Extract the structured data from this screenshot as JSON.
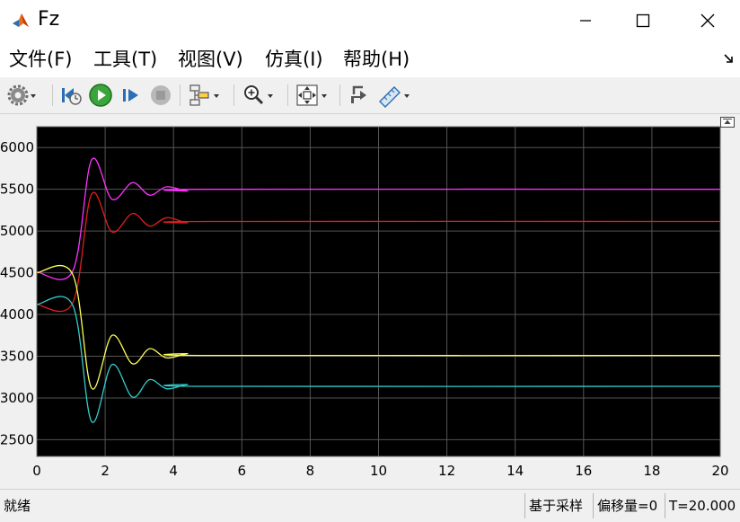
{
  "window": {
    "title": "Fz"
  },
  "menu": {
    "items": [
      "文件(F)",
      "工具(T)",
      "视图(V)",
      "仿真(I)",
      "帮助(H)"
    ]
  },
  "toolbar": {
    "buttons": [
      "settings-icon",
      "step-back-icon",
      "run-icon",
      "step-forward-icon",
      "stop-icon",
      "highlight-icon",
      "zoom-icon",
      "fit-to-view-icon",
      "restore-icon",
      "measure-icon"
    ]
  },
  "status": {
    "left": "就绪",
    "sample": "基于采样",
    "offset": "偏移量=0",
    "time": "T=20.000"
  },
  "colors": {
    "magenta": "#ff33ff",
    "red": "#e01f1f",
    "yellow": "#ffff55",
    "cyan": "#33cccc",
    "plot_bg": "#000000",
    "grid": "#555555"
  },
  "chart_data": {
    "type": "line",
    "title": "",
    "xlabel": "",
    "ylabel": "",
    "xlim": [
      0,
      20
    ],
    "ylim": [
      2300,
      6250
    ],
    "x_ticks": [
      "0",
      "2",
      "4",
      "6",
      "8",
      "10",
      "12",
      "14",
      "16",
      "18",
      "20"
    ],
    "y_ticks": [
      "2500",
      "3000",
      "3500",
      "4000",
      "4500",
      "5000",
      "5500",
      "6000"
    ],
    "x_tick_values": [
      0,
      2,
      4,
      6,
      8,
      10,
      12,
      14,
      16,
      18,
      20
    ],
    "y_tick_values": [
      2500,
      3000,
      3500,
      4000,
      4500,
      5000,
      5500,
      6000
    ],
    "grid": true,
    "series": [
      {
        "color": "magenta",
        "x": [
          0,
          1.05,
          1.6,
          2.2,
          2.8,
          3.3,
          3.8,
          4.4,
          5.0,
          20
        ],
        "y": [
          4510,
          4520,
          5850,
          5380,
          5580,
          5430,
          5530,
          5480,
          5500,
          5500
        ]
      },
      {
        "color": "red",
        "x": [
          0,
          1.05,
          1.6,
          2.2,
          2.8,
          3.3,
          3.8,
          4.4,
          5.0,
          20
        ],
        "y": [
          4120,
          4140,
          5440,
          4990,
          5210,
          5060,
          5160,
          5100,
          5115,
          5115
        ]
      },
      {
        "color": "yellow",
        "x": [
          0,
          1.05,
          1.6,
          2.2,
          2.8,
          3.3,
          3.8,
          4.4,
          5.0,
          20
        ],
        "y": [
          4500,
          4480,
          3120,
          3750,
          3410,
          3590,
          3480,
          3530,
          3510,
          3510
        ]
      },
      {
        "color": "cyan",
        "x": [
          0,
          1.05,
          1.6,
          2.2,
          2.8,
          3.3,
          3.8,
          4.4,
          5.0,
          20
        ],
        "y": [
          4120,
          4110,
          2720,
          3400,
          3010,
          3220,
          3110,
          3160,
          3140,
          3140
        ]
      }
    ]
  }
}
